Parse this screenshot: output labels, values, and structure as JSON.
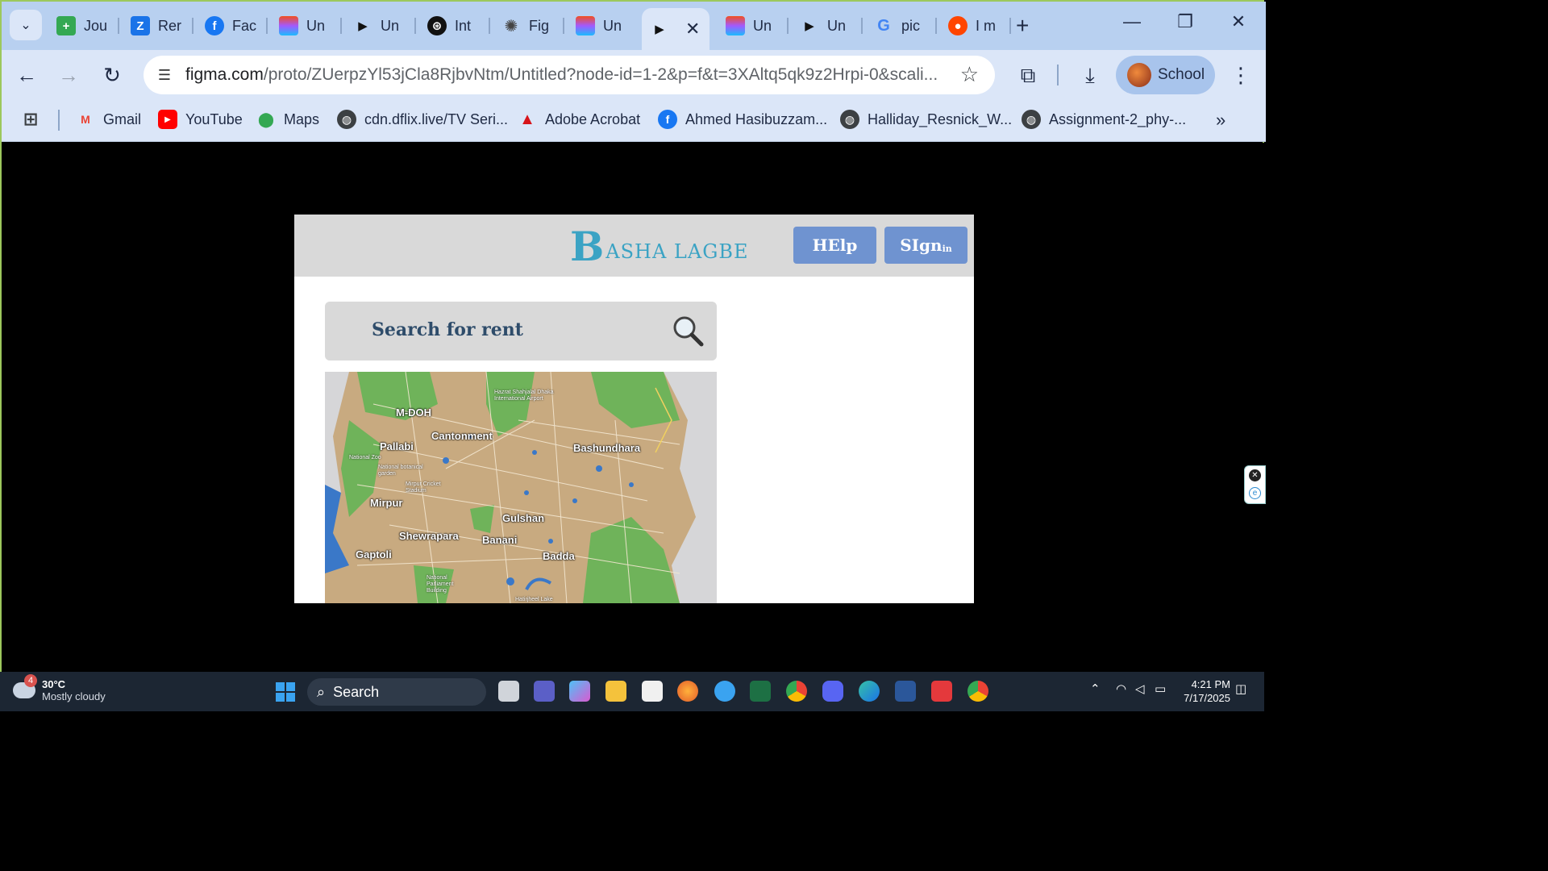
{
  "browser": {
    "tabs": [
      {
        "label": "Jou",
        "icon": "sheets-icon",
        "color": "#34a853"
      },
      {
        "label": "Rer",
        "icon": "zillow-icon",
        "color": "#1a73e8"
      },
      {
        "label": "Fac",
        "icon": "facebook-icon",
        "color": "#1877f2"
      },
      {
        "label": "Un",
        "icon": "figma-icon",
        "color": "#a259ff"
      },
      {
        "label": "Un",
        "icon": "play-icon",
        "color": "#111111"
      },
      {
        "label": "Int",
        "icon": "chatgpt-icon",
        "color": "#111111"
      },
      {
        "label": "Fig",
        "icon": "openai-icon",
        "color": "#444444"
      },
      {
        "label": "Un",
        "icon": "figma-icon",
        "color": "#a259ff"
      },
      {
        "label": "",
        "icon": "play-icon",
        "color": "#111111"
      },
      {
        "label": "Un",
        "icon": "figma-icon",
        "color": "#a259ff"
      },
      {
        "label": "Un",
        "icon": "play-icon",
        "color": "#111111"
      },
      {
        "label": "pic",
        "icon": "google-icon",
        "color": "#4285f4"
      },
      {
        "label": "I m",
        "icon": "reddit-icon",
        "color": "#ff4500"
      }
    ],
    "url_main": "figma.com",
    "url_rest": "/proto/ZUerpzYl53jCla8RjbvNtm/Untitled?node-id=1-2&p=f&t=3XAltq5qk9z2Hrpi-0&scali...",
    "profile_label": "School",
    "bookmarks": [
      {
        "label": "Gmail",
        "icon": "gmail-icon",
        "color": "#ea4335"
      },
      {
        "label": "YouTube",
        "icon": "youtube-icon",
        "color": "#ff0000"
      },
      {
        "label": "Maps",
        "icon": "maps-icon",
        "color": "#34a853"
      },
      {
        "label": "cdn.dflix.live/TV Seri...",
        "icon": "globe-icon",
        "color": "#3c4043"
      },
      {
        "label": "Adobe Acrobat",
        "icon": "acrobat-icon",
        "color": "#d7141a"
      },
      {
        "label": "Ahmed Hasibuzzam...",
        "icon": "facebook-icon",
        "color": "#1877f2"
      },
      {
        "label": "Halliday_Resnick_W...",
        "icon": "globe-icon",
        "color": "#3c4043"
      },
      {
        "label": "Assignment-2_phy-...",
        "icon": "globe-icon",
        "color": "#3c4043"
      }
    ]
  },
  "app": {
    "logo_letter": "B",
    "logo_rest": "ASHA LAGBE",
    "help_label": "HElp",
    "signin_label": "SIgn",
    "signin_suffix": "in",
    "search_placeholder": "Search for rent",
    "map_labels": {
      "mdoh": "M-DOH",
      "cantonment": "Cantonment",
      "pallabi": "Pallabi",
      "bashundhara": "Bashundhara",
      "mirpur": "Mirpur",
      "gulshan": "Gulshan",
      "shewrapara": "Shewrapara",
      "banani": "Banani",
      "gaptoli": "Gaptoli",
      "badda": "Badda",
      "airport": "Hazrat Shahjalal Dhaka International Airport",
      "zoo": "National Zoo",
      "botanical": "National botanical garden",
      "stadium": "Mirpur Cricket Stadium",
      "parliament": "National Parliament Building",
      "hatirjheel": "Hatirjheel Lake"
    }
  },
  "taskbar": {
    "weather_temp": "30°C",
    "weather_desc": "Mostly cloudy",
    "weather_badge": "4",
    "search_label": "Search",
    "time": "4:21 PM",
    "date": "7/17/2025"
  }
}
